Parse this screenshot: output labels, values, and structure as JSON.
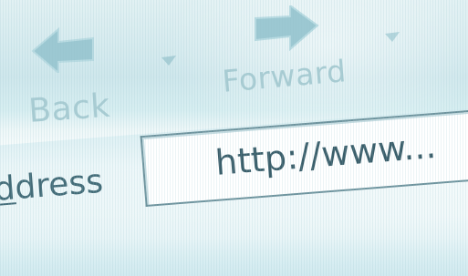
{
  "toolbar": {
    "back": {
      "label": "Back",
      "icon": "back-arrow-icon"
    },
    "forward": {
      "label": "Forward",
      "icon": "forward-arrow-icon"
    },
    "dropdown_icon": "chevron-down-icon"
  },
  "address_bar": {
    "label_prefix": "",
    "label_accel": "d",
    "label_suffix": "dress",
    "value": "http://www..."
  },
  "colors": {
    "arrow_fill": "#9cc8d2",
    "label_text": "#446c78",
    "url_text": "#3c5f6b",
    "field_border": "#6e939d"
  }
}
